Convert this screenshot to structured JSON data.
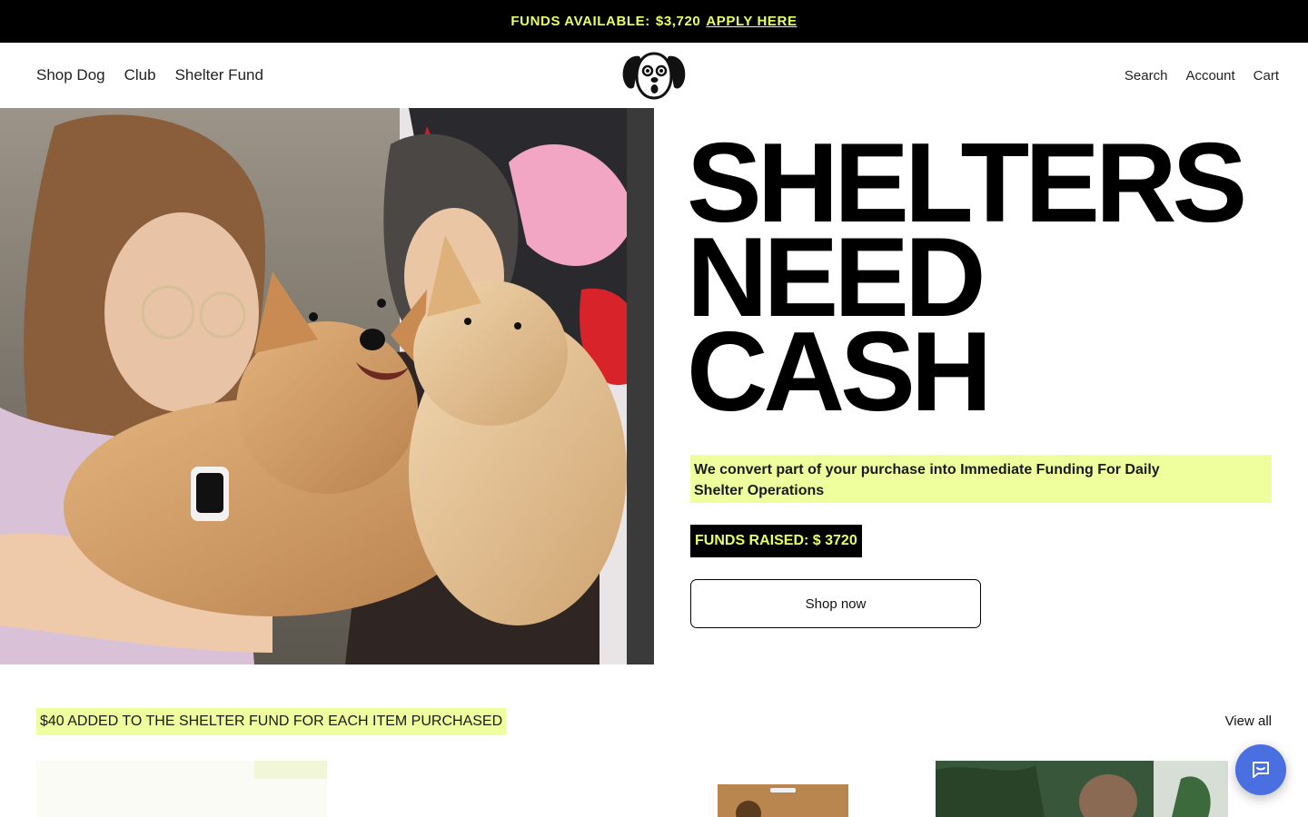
{
  "announcement": {
    "label": "FUNDS AVAILABLE:",
    "amount": "$3,720",
    "link": "APPLY HERE"
  },
  "nav": {
    "left": [
      "Shop Dog",
      "Club",
      "Shelter Fund"
    ],
    "search": "Search",
    "account": "Account",
    "cart": "Cart",
    "logo_icon": "dog-face-logo"
  },
  "hero": {
    "headline": [
      "SHELTERS",
      "NEED",
      "CASH"
    ],
    "subhead": "We convert part of your purchase into Immediate Funding For Daily Shelter Operations",
    "funds_raised": "FUNDS RAISED: $ 3720",
    "cta": "Shop now"
  },
  "collection": {
    "badge": "$40 ADDED TO THE SHELTER FUND FOR EACH ITEM PURCHASED",
    "view_all": "View all"
  },
  "colors": {
    "accent_yellow": "#e9ff63",
    "highlight": "#efff9e",
    "chat": "#4a6fe0"
  },
  "chat": {
    "icon": "chat-bubble-icon"
  }
}
